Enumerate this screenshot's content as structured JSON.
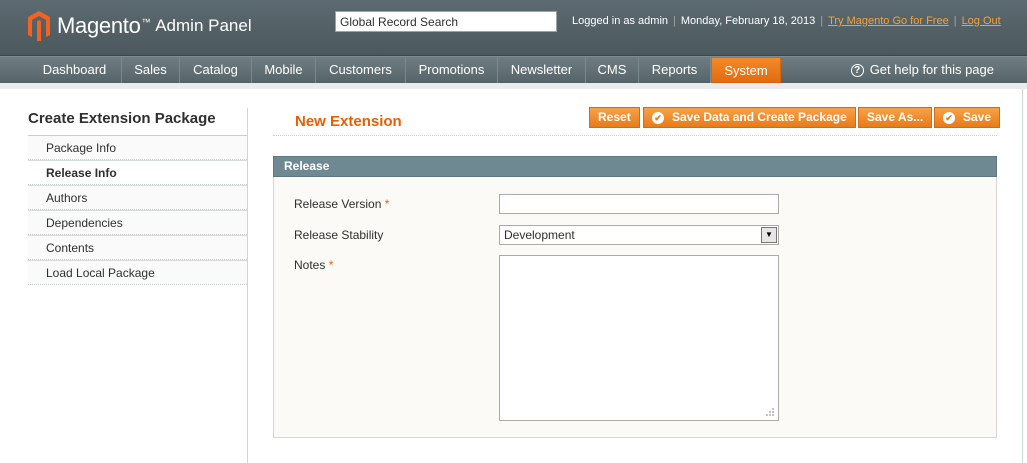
{
  "header": {
    "brand": "Magento",
    "brand_suffix": "Admin Panel",
    "search_value": "Global Record Search",
    "logged_in": "Logged in as admin",
    "date": "Monday, February 18, 2013",
    "try_link": "Try Magento Go for Free",
    "logout": "Log Out"
  },
  "nav": {
    "items": [
      "Dashboard",
      "Sales",
      "Catalog",
      "Mobile",
      "Customers",
      "Promotions",
      "Newsletter",
      "CMS",
      "Reports",
      "System"
    ],
    "active": "System",
    "help": "Get help for this page"
  },
  "sidebar": {
    "title": "Create Extension Package",
    "tabs": [
      "Package Info",
      "Release Info",
      "Authors",
      "Dependencies",
      "Contents",
      "Load Local Package"
    ],
    "active_tab": "Release Info"
  },
  "content": {
    "title": "New Extension",
    "buttons": {
      "reset": "Reset",
      "save_create": "Save Data and Create Package",
      "save_as": "Save As...",
      "save": "Save"
    },
    "fieldset": {
      "legend": "Release",
      "release_version_label": "Release Version",
      "release_version_value": "",
      "release_stability_label": "Release Stability",
      "release_stability_value": "Development",
      "notes_label": "Notes",
      "required_mark": "*"
    }
  },
  "colors": {
    "accent": "#eb5e00",
    "button": "#e87b18",
    "header_bg": "#56646a",
    "fieldset_head": "#6f8992"
  }
}
